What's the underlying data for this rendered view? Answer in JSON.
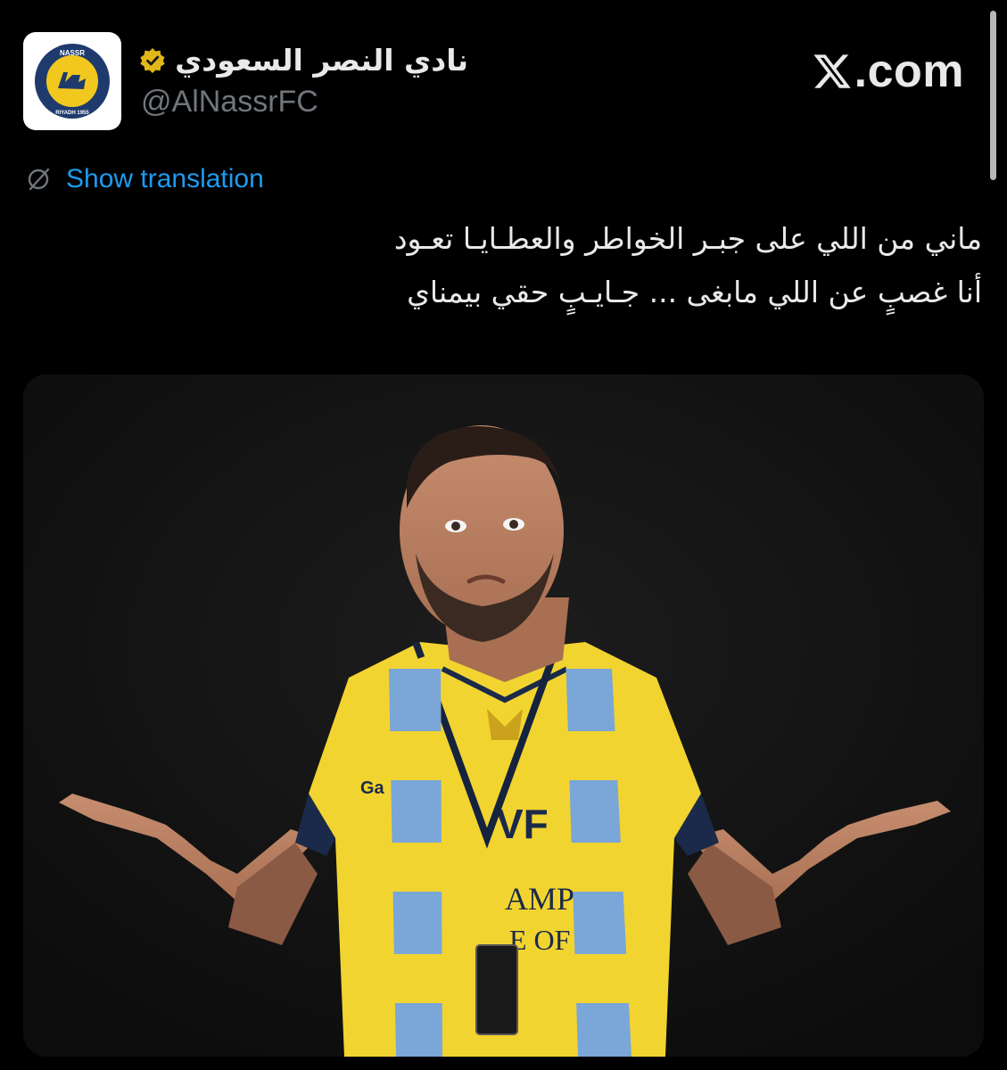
{
  "account": {
    "display_name": "نادي النصر السعودي",
    "handle": "@AlNassrFC",
    "verified": true,
    "avatar_icon": "al-nassr-crest-icon",
    "avatar_text_top": "NASSR",
    "avatar_text_bottom": "RIYADH 1955"
  },
  "site": {
    "label": ".com",
    "logo_icon": "x-logo-icon"
  },
  "translation": {
    "label": "Show translation",
    "icon": "translate-icon"
  },
  "tweet": {
    "line1": "ماني من اللي على جبـر الخواطر والعطـايـا تعـود",
    "line2": "أنا غصبٍ عن اللي مابغى ... جـايـبٍ حقي بيمناي"
  },
  "media": {
    "description_icon": "player-photo",
    "shirt_text_1": "VF",
    "shirt_text_2": "AMPIO",
    "shirt_text_3": "E OF M",
    "sponsor_text": "Ga"
  },
  "colors": {
    "background": "#000000",
    "text": "#e7e9ea",
    "secondary": "#71767b",
    "link": "#1d9bf0",
    "jersey_yellow": "#f2d431",
    "scarf_blue": "#7aa6d8",
    "verified_gold": "#e2b719"
  }
}
